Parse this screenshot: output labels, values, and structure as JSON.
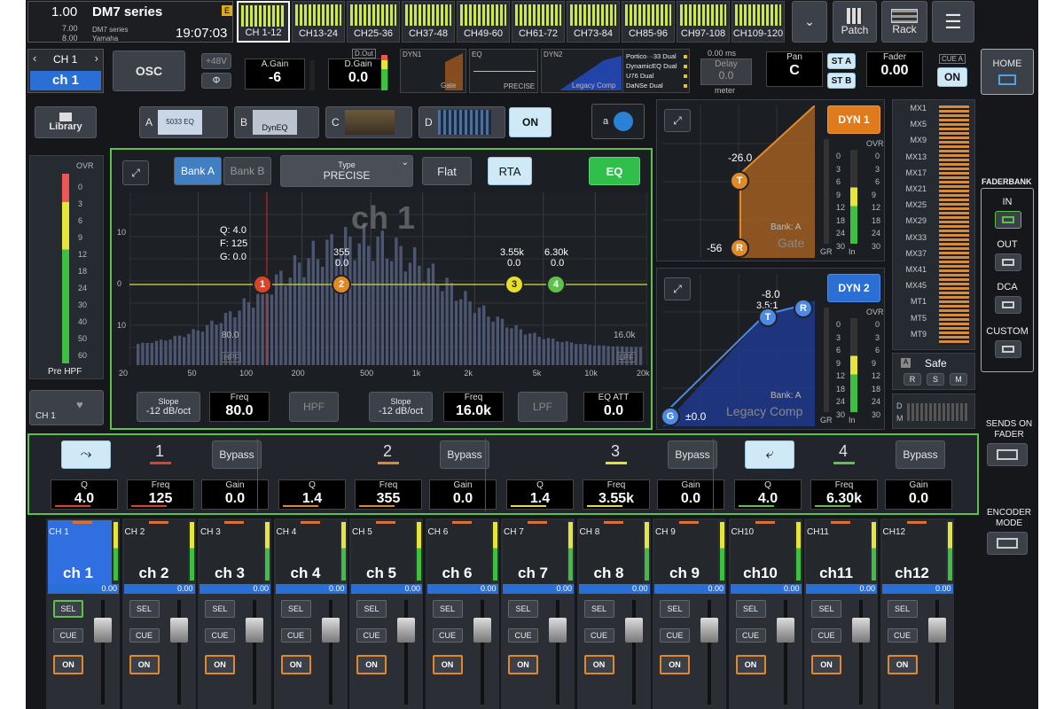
{
  "scene": {
    "number": "1.00",
    "name": "DM7 series",
    "sub_number": "7.00",
    "sub_number2": "8.00",
    "sub_name": "DM7 series",
    "sub_maker": "Yamaha",
    "time": "19:07:03",
    "badge": "E"
  },
  "channel_tabs": [
    "CH 1-12",
    "CH13-24",
    "CH25-36",
    "CH37-48",
    "CH49-60",
    "CH61-72",
    "CH73-84",
    "CH85-96",
    "CH97-108",
    "CH109-120"
  ],
  "top_buttons": {
    "patch": "Patch",
    "rack": "Rack"
  },
  "selected": {
    "id": "CH 1",
    "name": "ch 1",
    "osc": "OSC",
    "phantom": "+48V",
    "phase": "Φ",
    "again_label": "A.Gain",
    "again": "-6",
    "dgain_label": "D.Gain",
    "dgain": "0.0",
    "dout": "D.Out",
    "dyn1": "DYN1",
    "gate": "Gate",
    "eq": "EQ",
    "precise": "PRECISE",
    "dyn2": "DYN2",
    "legacy": "Legacy Comp",
    "plugins": [
      "Portico···33 Dual",
      "DynamicEQ Dual",
      "U76 Dual",
      "DaNSe Dual"
    ],
    "delay_ms": "0.00 ms",
    "delay_label": "Delay",
    "delay_val": "0.0",
    "meter": "meter",
    "pan_label": "Pan",
    "pan": "C",
    "sta": "ST A",
    "stb": "ST B",
    "fader_label": "Fader",
    "fader": "0.00",
    "cue_a": "CUE A",
    "on": "ON",
    "home": "HOME"
  },
  "inserts": {
    "library": "Library",
    "a": "A",
    "b": "B",
    "c": "C",
    "d": "D",
    "dyneq": "DynEQ",
    "eq5033": "5033 EQ",
    "on": "ON",
    "a_label": "a"
  },
  "eq": {
    "bank_a": "Bank A",
    "bank_b": "Bank B",
    "type_label": "Type",
    "type": "PRECISE",
    "flat": "Flat",
    "rta": "RTA",
    "eq": "EQ",
    "ch": "ch 1",
    "q_info": "Q: 4.0",
    "f_info": "F: 125",
    "g_info": "G: 0.0",
    "b2_freq": "355",
    "b2_gain": "0.0",
    "b3_freq": "3.55k",
    "b3_gain": "0.0",
    "b4_freq": "6.30k",
    "b4_gain": "0.0",
    "hpf_freq": "80.0",
    "lpf_freq": "16.0k",
    "hpf_tag": "HPF",
    "lpf_tag": "LPF",
    "yticks": [
      "10",
      "0",
      "10"
    ],
    "xticks": [
      "20",
      "50",
      "100",
      "200",
      "500",
      "1k",
      "2k",
      "5k",
      "10k",
      "20k"
    ],
    "slope_label": "Slope",
    "slope1": "-12 dB/oct",
    "freq_label": "Freq",
    "hpf_val": "80.0",
    "hpf_btn": "HPF",
    "slope2": "-12 dB/oct",
    "lpf_val": "16.0k",
    "lpf_btn": "LPF",
    "att_label": "EQ ATT",
    "att": "0.0"
  },
  "pre_meter": {
    "ovr": "OVR",
    "ticks": [
      "0",
      "3",
      "6",
      "9",
      "12",
      "18",
      "24",
      "30",
      "40",
      "50",
      "60"
    ],
    "label": "Pre HPF",
    "ch": "CH 1"
  },
  "gate": {
    "btn": "DYN 1",
    "thr": "-26.0",
    "range": "-56",
    "bank": "Bank: A",
    "name": "Gate",
    "gr": "GR",
    "in": "In",
    "ovr": "OVR",
    "ticks": [
      "0",
      "3",
      "6",
      "9",
      "12",
      "18",
      "24",
      "30"
    ],
    "node_t": "T",
    "node_r": "R"
  },
  "comp": {
    "btn": "DYN 2",
    "thr": "-8.0",
    "ratio": "3.5:1",
    "bank": "Bank: A",
    "name": "Legacy Comp",
    "gain": "±0.0",
    "gr": "GR",
    "in": "In",
    "ovr": "OVR",
    "ticks": [
      "0",
      "3",
      "6",
      "9",
      "12",
      "18",
      "24",
      "30"
    ],
    "node_t": "T",
    "node_r": "R",
    "node_g": "G"
  },
  "mix": {
    "labels": [
      "MX1",
      "MX5",
      "MX9",
      "MX13",
      "MX17",
      "MX21",
      "MX25",
      "MX29",
      "MX33",
      "MX37",
      "MX41",
      "MX45",
      "MT1",
      "MT5",
      "MT9"
    ],
    "safe": "Safe",
    "safe_a": "A",
    "safe_r": "R",
    "safe_s": "S",
    "safe_m": "M",
    "d": "D",
    "m": "M"
  },
  "faderbank": {
    "title": "FADERBANK",
    "in": "IN",
    "out": "OUT",
    "dca": "DCA",
    "custom": "CUSTOM",
    "sends": "SENDS ON FADER",
    "encoder": "ENCODER MODE"
  },
  "bands": [
    {
      "num": "1",
      "bypass": "Bypass",
      "q": "4.0",
      "freq": "125",
      "gain": "0.0",
      "color": "#d9452b"
    },
    {
      "num": "2",
      "bypass": "Bypass",
      "q": "1.4",
      "freq": "355",
      "gain": "0.0",
      "color": "#e0892b"
    },
    {
      "num": "3",
      "bypass": "Bypass",
      "q": "1.4",
      "freq": "3.55k",
      "gain": "0.0",
      "color": "#e6df2b"
    },
    {
      "num": "4",
      "bypass": "Bypass",
      "q": "4.0",
      "freq": "6.30k",
      "gain": "0.0",
      "color": "#5cc24a"
    }
  ],
  "band_labels": {
    "q": "Q",
    "freq": "Freq",
    "gain": "Gain"
  },
  "strips": [
    {
      "id": "CH 1",
      "name": "ch 1",
      "level": "0.00"
    },
    {
      "id": "CH 2",
      "name": "ch 2",
      "level": "0.00"
    },
    {
      "id": "CH 3",
      "name": "ch 3",
      "level": "0.00"
    },
    {
      "id": "CH 4",
      "name": "ch 4",
      "level": "0.00"
    },
    {
      "id": "CH 5",
      "name": "ch 5",
      "level": "0.00"
    },
    {
      "id": "CH 6",
      "name": "ch 6",
      "level": "0.00"
    },
    {
      "id": "CH 7",
      "name": "ch 7",
      "level": "0.00"
    },
    {
      "id": "CH 8",
      "name": "ch 8",
      "level": "0.00"
    },
    {
      "id": "CH 9",
      "name": "ch 9",
      "level": "0.00"
    },
    {
      "id": "CH10",
      "name": "ch10",
      "level": "0.00"
    },
    {
      "id": "CH11",
      "name": "ch11",
      "level": "0.00"
    },
    {
      "id": "CH12",
      "name": "ch12",
      "level": "0.00"
    }
  ],
  "strip_buttons": {
    "sel": "SEL",
    "cue": "CUE",
    "on": "ON"
  }
}
